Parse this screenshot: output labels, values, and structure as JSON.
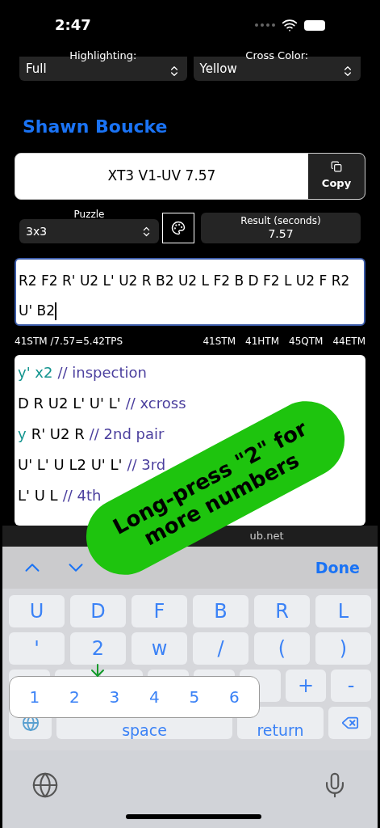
{
  "status_bar": {
    "time": "2:47"
  },
  "selects": [
    {
      "label": "Highlighting:",
      "value": "Full"
    },
    {
      "label": "Cross Color:",
      "value": "Yellow"
    }
  ],
  "solver_name": "Shawn Boucke",
  "scramble_title": "XT3 V1-UV 7.57",
  "copy_button": "Copy",
  "puzzle": {
    "label": "Puzzle",
    "value": "3x3"
  },
  "result": {
    "label": "Result (seconds)",
    "value": "7.57"
  },
  "scramble_text": "R2 F2 R' U2 L' U2 R B2 U2 L F2 B D F2 L U2 F R2 U' B2",
  "stats": {
    "tps": "41STM /7.57=5.42TPS",
    "counts": [
      "41STM",
      "41HTM",
      "45QTM",
      "44ETM"
    ]
  },
  "solution_lines": [
    [
      {
        "kind": "rotation",
        "text": "y' x2"
      },
      {
        "kind": "comment",
        "text": "// inspection"
      }
    ],
    [
      {
        "kind": "move",
        "text": "D R U2 L' U' L'"
      },
      {
        "kind": "comment",
        "text": "// xcross"
      }
    ],
    [
      {
        "kind": "rotation",
        "text": "y"
      },
      {
        "kind": "move",
        "text": "R' U2 R"
      },
      {
        "kind": "comment",
        "text": "// 2nd pair"
      }
    ],
    [
      {
        "kind": "move",
        "text": "U' L' U L2 U' L'"
      },
      {
        "kind": "comment",
        "text": "// 3rd"
      }
    ],
    [
      {
        "kind": "move",
        "text": "L' U L"
      },
      {
        "kind": "comment",
        "text": "// 4th"
      }
    ]
  ],
  "url_bar": "ub.net",
  "accessory": {
    "done": "Done"
  },
  "keyboard": {
    "rows": [
      [
        "U",
        "D",
        "F",
        "B",
        "R",
        "L"
      ],
      [
        "'",
        "2",
        "w",
        "/",
        "(",
        ")"
      ]
    ],
    "row3": [
      "+",
      "-"
    ],
    "space": "space",
    "return": "return"
  },
  "number_popup": [
    "1",
    "2",
    "3",
    "4",
    "5",
    "6"
  ],
  "annotation": "Long-press \"2\" for more numbers"
}
